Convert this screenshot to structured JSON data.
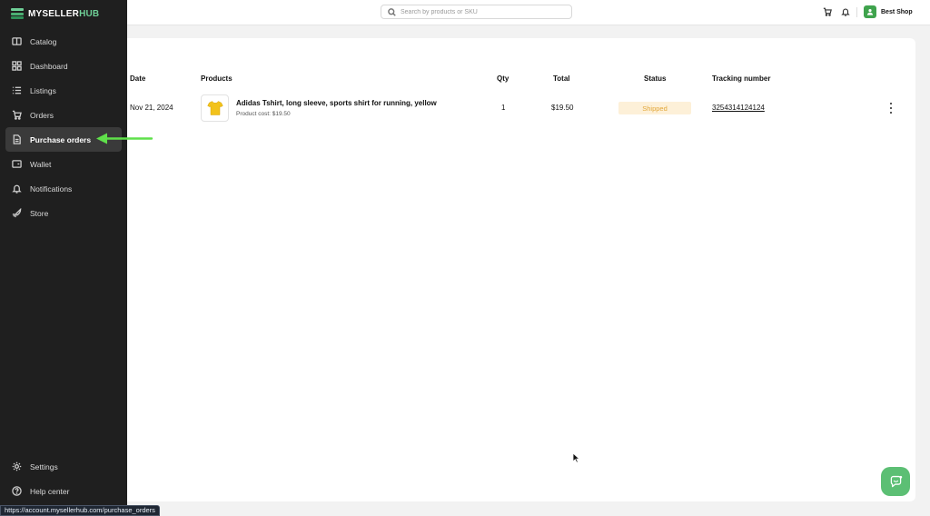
{
  "app": {
    "logo_main": "MYSELLER",
    "logo_accent": "HUB"
  },
  "sidebar": {
    "items": [
      {
        "label": "Catalog",
        "icon": "catalog-icon"
      },
      {
        "label": "Dashboard",
        "icon": "dashboard-icon"
      },
      {
        "label": "Listings",
        "icon": "list-icon"
      },
      {
        "label": "Orders",
        "icon": "cart-icon"
      },
      {
        "label": "Purchase orders",
        "icon": "document-icon",
        "active": true
      },
      {
        "label": "Wallet",
        "icon": "wallet-icon"
      },
      {
        "label": "Notifications",
        "icon": "bell-icon"
      },
      {
        "label": "Store",
        "icon": "rocket-icon"
      }
    ],
    "bottom_items": [
      {
        "label": "Settings",
        "icon": "gear-icon"
      },
      {
        "label": "Help center",
        "icon": "help-icon"
      }
    ]
  },
  "topbar": {
    "search_placeholder": "Search by products or SKU",
    "shop_name": "Best Shop",
    "accent_color": "#3fa34d"
  },
  "table": {
    "headers": {
      "date": "Date",
      "products": "Products",
      "qty": "Qty",
      "total": "Total",
      "status": "Status",
      "tracking": "Tracking number"
    },
    "rows": [
      {
        "date": "Nov 21, 2024",
        "product_title": "Adidas Tshirt, long sleeve, sports shirt for running, yellow",
        "product_cost": "Product cost: $19.50",
        "qty": "1",
        "total": "$19.50",
        "status": "Shipped",
        "tracking": "3254314124124"
      }
    ]
  },
  "status_bar": {
    "url": "https://account.mysellerhub.com/purchase_orders"
  },
  "colors": {
    "sidebar_bg": "#1f1f1f",
    "annotation_arrow": "#5fe04a",
    "status_badge_bg": "#fdf0d8",
    "status_badge_text": "#e2a73a",
    "chat_button": "#5cbf74"
  }
}
